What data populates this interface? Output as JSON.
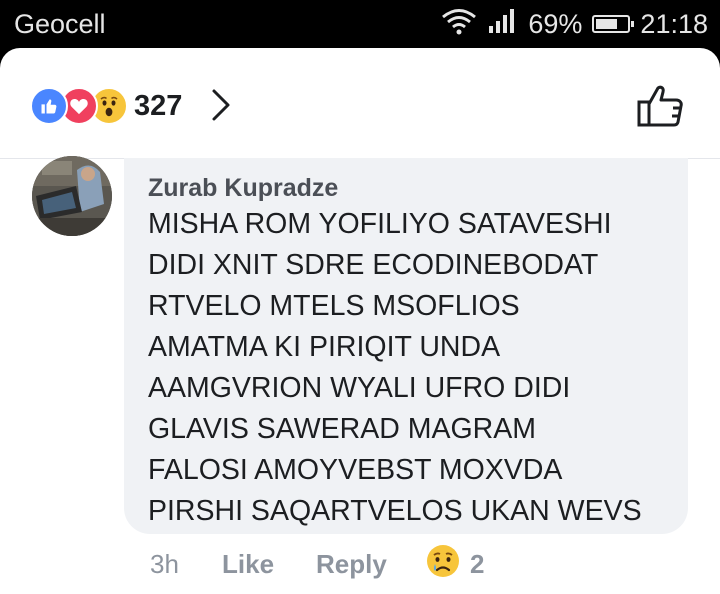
{
  "status_bar": {
    "carrier": "Geocell",
    "battery_text": "69%",
    "battery_level": 0.69,
    "time": "21:18"
  },
  "header": {
    "reactions": [
      "like",
      "love",
      "wow"
    ],
    "reaction_count": "327"
  },
  "comment": {
    "author": "Zurab Kupradze",
    "lines": [
      "MISHA ROM YOFILIYO SATAVESHI",
      "DIDI XNIT SDRE ECODINEBODAT",
      "RTVELO MTELS MSOFLIOS",
      "AMATMA KI PIRIQIT UNDA",
      "AAMGVRION WYALI UFRO DIDI",
      "GLAVIS SAWERAD MAGRAM",
      "FALOSI AMOYVEBST MOXVDA",
      "PIRSHI SAQARTVELOS UKAN WEVS"
    ],
    "time": "3h",
    "like_label": "Like",
    "reply_label": "Reply",
    "reaction": "sad",
    "reaction_count": "2"
  },
  "colors": {
    "like": "#4a86ff",
    "love": "#f0405e",
    "wow": "#f7c53b",
    "bubble": "#f0f2f5",
    "meta_text": "#8d949e"
  }
}
